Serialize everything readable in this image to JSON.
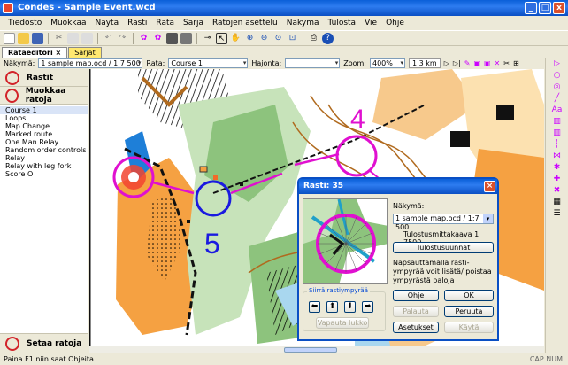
{
  "window": {
    "title": "Condes - Sample Event.wcd",
    "min": "_",
    "max": "□",
    "close": "x"
  },
  "menu": [
    "Tiedosto",
    "Muokkaa",
    "Näytä",
    "Rasti",
    "Rata",
    "Sarja",
    "Ratojen asettelu",
    "Näkymä",
    "Tulosta",
    "Vie",
    "Ohje"
  ],
  "tabs": [
    {
      "label": "Rataeditori"
    },
    {
      "label": "Sarjat"
    }
  ],
  "toolbar2": {
    "view_label": "Näkymä:",
    "view_value": "1 sample map.ocd  / 1:7 500",
    "course_label": "Rata:",
    "course_value": "Course 1",
    "spread_label": "Hajonta:",
    "spread_value": "",
    "zoom_label": "Zoom:",
    "zoom_value": "400%",
    "distance": "1,3 km"
  },
  "left": {
    "controls_button": "Rastit",
    "edit_courses_button": "Muokkaa ratoja",
    "courses": [
      "Course 1",
      "Loops",
      "Map Change",
      "Marked route",
      "One Man Relay",
      "Random order controls",
      "Relay",
      "Relay with leg fork",
      "Score O"
    ],
    "selected_course": "Course 1",
    "layout_button": "Setaa ratoja"
  },
  "map": {
    "control_number_1": "4",
    "control_number_2": "5"
  },
  "dialog": {
    "title": "Rasti: 35",
    "view_label": "Näkymä:",
    "view_value": "1 sample map.ocd   / 1:7 500",
    "print_scale": "Tulostusmittakaava  1: 7500",
    "print_settings_button": "Tulostusuunnat",
    "hint": "Napsauttamalla rasti-ympyrää voit lisätä/ poistaa ympyrästä paloja",
    "move_group": "Siirrä rastiympyrää",
    "unlock_button": "Vapauta lukko",
    "help_button": "Ohje",
    "ok_button": "OK",
    "restore_button": "Palauta",
    "cancel_button": "Peruuta",
    "settings_button": "Asetukset",
    "apply_button": "Käytä"
  },
  "status": {
    "text": "Paina F1 niin saat Ohjeita",
    "indicators": "CAP  NUM"
  }
}
